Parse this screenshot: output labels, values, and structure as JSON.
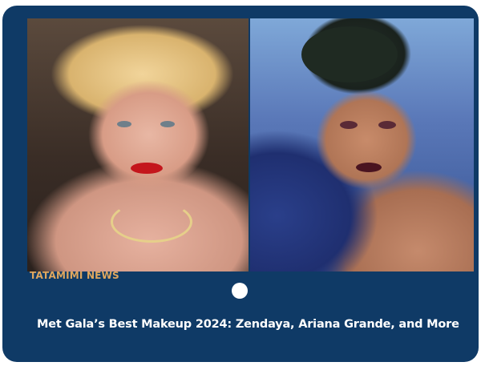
{
  "article": {
    "source": "TATAMIMI NEWS",
    "headline": "Met Gala’s Best Makeup 2024: Zendaya, Ariana Grande, and More",
    "images": [
      {
        "name": "left-photo",
        "subject": "blonde woman with bob hairstyle and red lipstick"
      },
      {
        "name": "right-photo",
        "subject": "woman with veiled hat and dark lipstick"
      }
    ]
  },
  "carousel": {
    "indicator": "dot"
  },
  "colors": {
    "card_background": "#0f3a66",
    "brand_text": "#e0a75e",
    "headline_text": "#ffffff",
    "indicator": "#ffffff"
  }
}
